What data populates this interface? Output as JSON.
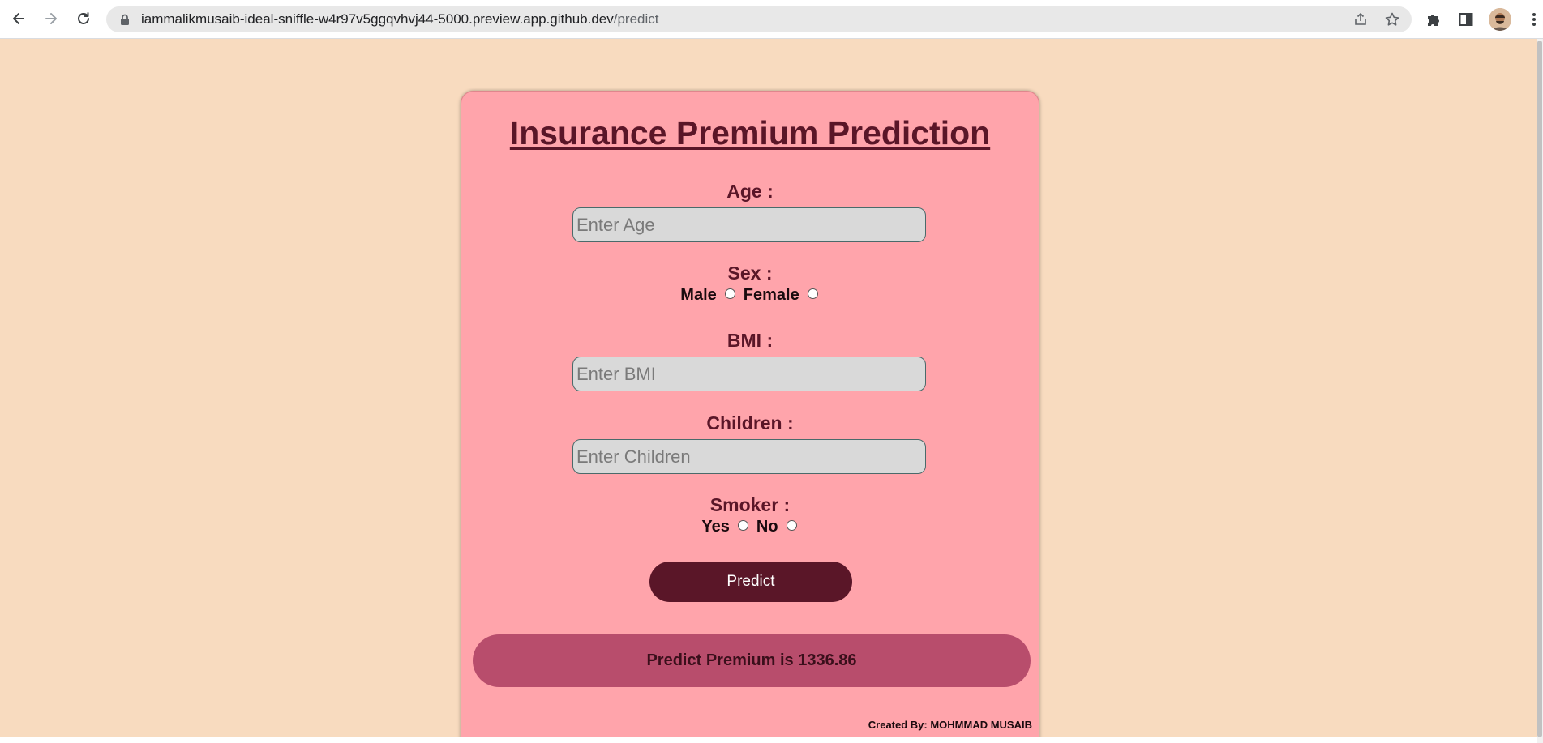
{
  "browser": {
    "url_host": "iammalikmusaib-ideal-sniffle-w4r97v5ggqvhvj44-5000.preview.app.github.dev",
    "url_path": "/predict",
    "icons": {
      "back": "arrow-left-icon",
      "forward": "arrow-right-icon",
      "reload": "reload-icon",
      "lock": "lock-icon",
      "share": "share-icon",
      "bookmark": "star-icon",
      "extensions": "puzzle-icon",
      "side_panel": "side-panel-icon",
      "menu": "kebab-menu-icon"
    }
  },
  "page": {
    "background": "#f8dbbf",
    "card_color": "#ffa4ab",
    "accent_color": "#5a1628",
    "result_color": "#b84d6c",
    "title": "Insurance Premium Prediction",
    "age": {
      "label": "Age :",
      "placeholder": "Enter Age",
      "value": ""
    },
    "sex": {
      "label": "Sex :",
      "options": [
        "Male",
        "Female"
      ]
    },
    "bmi": {
      "label": "BMI :",
      "placeholder": "Enter BMI",
      "value": ""
    },
    "children": {
      "label": "Children :",
      "placeholder": "Enter Children",
      "value": ""
    },
    "smoker": {
      "label": "Smoker :",
      "options": [
        "Yes",
        "No"
      ]
    },
    "predict_button": "Predict",
    "result_text": "Predict Premium is 1336.86",
    "credit": "Created By: MOHMMAD MUSAIB"
  }
}
